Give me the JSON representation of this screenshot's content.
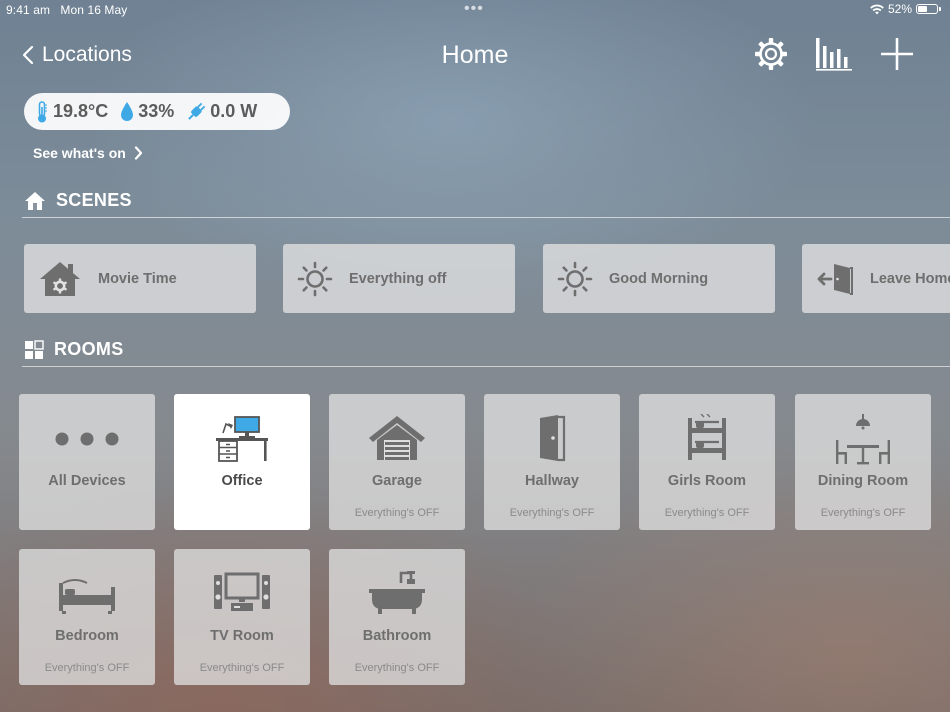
{
  "status_bar": {
    "time": "9:41 am",
    "date": "Mon 16 May",
    "battery": "52%",
    "battery_level": 0.52
  },
  "nav": {
    "back_label": "Locations",
    "title": "Home",
    "icons": [
      "gear-icon",
      "bar-chart-icon",
      "plus-icon"
    ]
  },
  "sensors": {
    "temperature": "19.8°C",
    "humidity": "33%",
    "power": "0.0 W"
  },
  "see_whats_on": "See what's on",
  "scenes": {
    "header": "SCENES",
    "items": [
      {
        "label": "Movie Time",
        "icon": "house-gear-icon"
      },
      {
        "label": "Everything off",
        "icon": "sun-icon"
      },
      {
        "label": "Good Morning",
        "icon": "sun-icon"
      },
      {
        "label": "Leave Home",
        "icon": "door-exit-icon"
      }
    ]
  },
  "rooms": {
    "header": "ROOMS",
    "items": [
      {
        "name": "All Devices",
        "status": "",
        "icon": "three-dots-icon"
      },
      {
        "name": "Office",
        "status": "",
        "icon": "desk-icon",
        "selected": true
      },
      {
        "name": "Garage",
        "status": "Everything's OFF",
        "icon": "garage-icon"
      },
      {
        "name": "Hallway",
        "status": "Everything's OFF",
        "icon": "door-icon"
      },
      {
        "name": "Girls Room",
        "status": "Everything's OFF",
        "icon": "bunk-bed-icon"
      },
      {
        "name": "Dining Room",
        "status": "Everything's OFF",
        "icon": "dining-table-icon"
      },
      {
        "name": "Bedroom",
        "status": "Everything's OFF",
        "icon": "bed-icon"
      },
      {
        "name": "TV Room",
        "status": "Everything's OFF",
        "icon": "tv-icon"
      },
      {
        "name": "Bathroom",
        "status": "Everything's OFF",
        "icon": "bathtub-icon"
      }
    ]
  },
  "colors": {
    "accent_blue": "#3fa9e6",
    "tile_text": "#6e6e6e"
  }
}
